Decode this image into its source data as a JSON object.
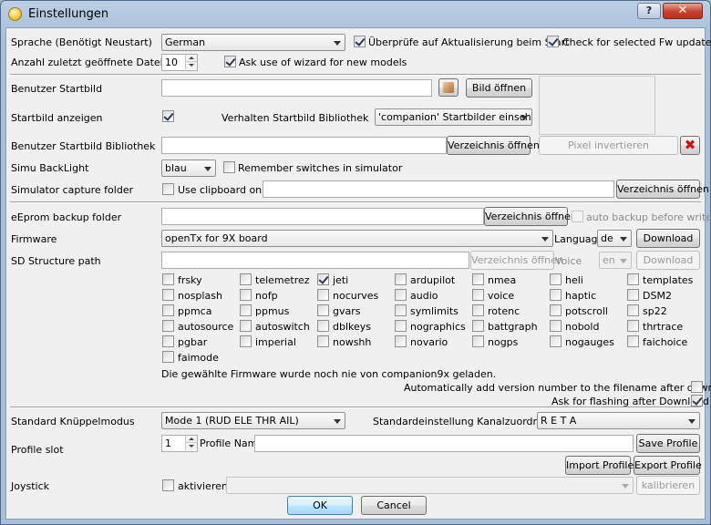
{
  "window": {
    "title": "Einstellungen",
    "help_glyph": "?",
    "close_glyph": "✕"
  },
  "lang": {
    "label": "Sprache (Benötigt Neustart)",
    "value": "German"
  },
  "update_check": {
    "label": "Überprüfe auf Aktualisierung beim Start",
    "checked": true
  },
  "fw_check": {
    "label": "Check for selected Fw updates",
    "checked": true
  },
  "recent": {
    "label": "Anzahl zuletzt geöffnete Dateien",
    "value": "10"
  },
  "wizard": {
    "label": "Ask use of wizard for new models",
    "checked": true
  },
  "splash": {
    "label": "Benutzer Startbild",
    "open_button": "Bild öffnen"
  },
  "show_splash": {
    "label": "Startbild anzeigen",
    "checked": true
  },
  "library_behavior": {
    "label": "Verhalten Startbild Bibliothek",
    "value": "'companion' Startbilder einschliessen"
  },
  "splash_library": {
    "label": "Benutzer Startbild Bibliothek",
    "dir_button": "Verzeichnis öffnen",
    "invert_button": "Pixel invertieren",
    "clear_glyph": "✖"
  },
  "backlight": {
    "label": "Simu BackLight",
    "value": "blau"
  },
  "remember_switches": {
    "label": "Remember switches in simulator",
    "checked": false
  },
  "capture": {
    "label": "Simulator capture folder",
    "clipboard_label": "Use clipboard only",
    "dir_button": "Verzeichnis öffnen"
  },
  "backup": {
    "label": "eEprom backup folder",
    "dir_button": "Verzeichnis öffnen",
    "auto_label": "auto backup before write"
  },
  "firmware": {
    "label": "Firmware",
    "value": "openTx for 9X board",
    "language_label": "Language",
    "language_value": "de",
    "download_button": "Download"
  },
  "sd": {
    "label": "SD Structure path",
    "dir_button": "Verzeichnis öffnen",
    "voice_label": "Voice",
    "voice_value": "en",
    "download_button": "Download"
  },
  "options": {
    "rows": [
      [
        "frsky",
        "telemetrez",
        "jeti",
        "ardupilot",
        "nmea",
        "heli",
        "templates"
      ],
      [
        "nosplash",
        "nofp",
        "nocurves",
        "audio",
        "voice",
        "haptic",
        "DSM2"
      ],
      [
        "ppmca",
        "ppmus",
        "gvars",
        "symlimits",
        "rotenc",
        "potscroll",
        "sp22"
      ],
      [
        "autosource",
        "autoswitch",
        "dblkeys",
        "nographics",
        "battgraph",
        "nobold",
        "thrtrace"
      ],
      [
        "pgbar",
        "imperial",
        "nowshh",
        "novario",
        "nogps",
        "nogauges",
        "faichoice"
      ],
      [
        "faimode"
      ]
    ],
    "checked": [
      "jeti"
    ]
  },
  "fw_notice": "Die gewählte Firmware wurde noch nie von companion9x geladen.",
  "auto_version": {
    "label": "Automatically add version number to the filename after download",
    "checked": false
  },
  "flash_after": {
    "label": "Ask for flashing after Download",
    "checked": true
  },
  "stick_mode": {
    "label": "Standard Knüppelmodus",
    "value": "Mode 1 (RUD ELE THR AIL)"
  },
  "channel_order": {
    "label": "Standardeinstellung Kanalzuordnung",
    "value": "R E T A"
  },
  "profile": {
    "label": "Profile slot",
    "slot": "1",
    "name_label": "Profile Name",
    "save_button": "Save Profile",
    "import_button": "Import Profile",
    "export_button": "Export Profile"
  },
  "joystick": {
    "label": "Joystick",
    "activate_label": "aktivieren",
    "calibrate_button": "kalibrieren"
  },
  "footer": {
    "ok": "OK",
    "cancel": "Cancel"
  }
}
